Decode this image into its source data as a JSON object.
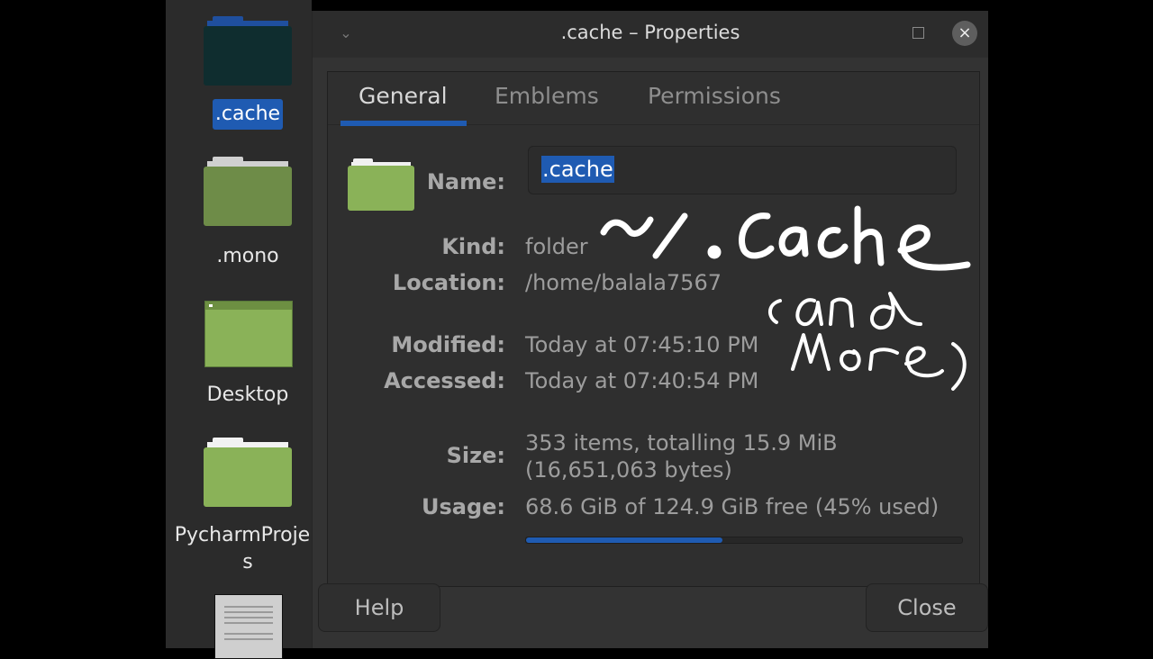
{
  "desktop": {
    "items": [
      {
        "label": ".cache",
        "icon": "folder-selected-icon",
        "selected": true
      },
      {
        "label": ".mono",
        "icon": "folder-icon",
        "selected": false
      },
      {
        "label": "Desktop",
        "icon": "desktop-folder-icon",
        "selected": false
      },
      {
        "label": "PycharmProje",
        "label2": "s",
        "icon": "folder-icon",
        "selected": false
      },
      {
        "label": "",
        "icon": "document-icon",
        "selected": false
      }
    ]
  },
  "dialog": {
    "title": ".cache – Properties",
    "menu_icon": "chevron-down-icon",
    "maximize_icon": "maximize-icon",
    "close_icon": "×",
    "tabs": [
      {
        "label": "General",
        "active": true
      },
      {
        "label": "Emblems",
        "active": false
      },
      {
        "label": "Permissions",
        "active": false
      }
    ],
    "fields": {
      "name_label": "Name:",
      "name_value": ".cache",
      "kind_label": "Kind:",
      "kind_value": "folder",
      "location_label": "Location:",
      "location_value": "/home/balala7567",
      "modified_label": "Modified:",
      "modified_value": "Today at 07:45:10 PM",
      "accessed_label": "Accessed:",
      "accessed_value": "Today at 07:40:54 PM",
      "size_label": "Size:",
      "size_value_line1": "353 items, totalling 15.9 MiB",
      "size_value_line2": "(16,651,063 bytes)",
      "usage_label": "Usage:",
      "usage_value": "68.6 GiB of 124.9 GiB free (45% used)",
      "usage_percent": 45
    },
    "buttons": {
      "help": "Help",
      "close": "Close"
    },
    "accent_color": "#1f5bb2"
  },
  "annotation": {
    "handwritten_text": "~/.cache (and more)"
  }
}
